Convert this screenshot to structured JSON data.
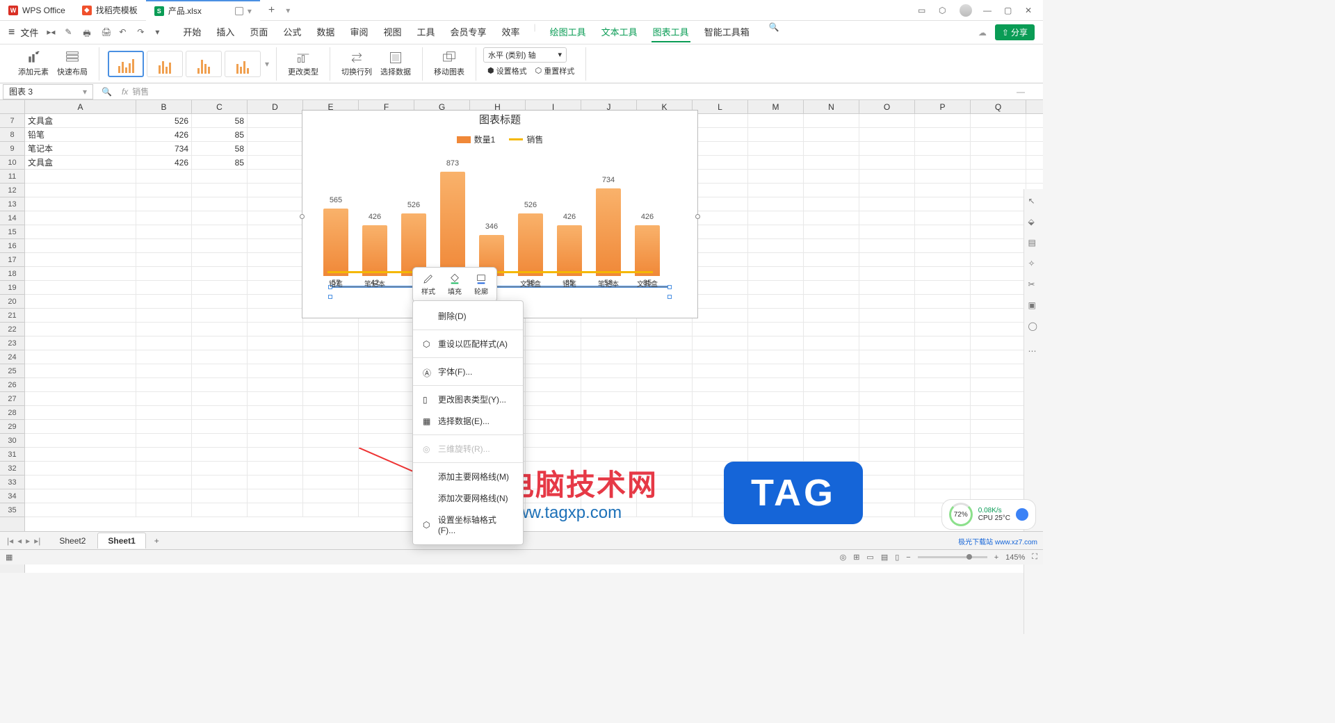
{
  "titlebar": {
    "tabs": [
      {
        "icon": "W",
        "label": "WPS Office",
        "color": "red"
      },
      {
        "icon": "D",
        "label": "找稻壳模板",
        "color": "orange"
      },
      {
        "icon": "S",
        "label": "产品.xlsx",
        "color": "green",
        "active": true
      }
    ]
  },
  "menu": {
    "file": "文件",
    "tabs": [
      "开始",
      "插入",
      "页面",
      "公式",
      "数据",
      "审阅",
      "视图",
      "工具",
      "会员专享",
      "效率"
    ],
    "tool_tabs": [
      "绘图工具",
      "文本工具",
      "图表工具",
      "智能工具箱"
    ],
    "active_tool": "图表工具",
    "share": "分享"
  },
  "ribbon": {
    "add_element": "添加元素",
    "quick_layout": "快速布局",
    "change_type": "更改类型",
    "switch_rc": "切换行列",
    "select_data": "选择数据",
    "move_chart": "移动图表",
    "axis_select": "水平 (类别) 轴",
    "set_format": "设置格式",
    "reset_style": "重置样式"
  },
  "namebox": "图表 3",
  "formula": "销售",
  "columns": {
    "A": 160,
    "B": 80,
    "C": 80,
    "D": 80,
    "E": 80,
    "F": 80,
    "G": 80,
    "H": 80,
    "I": 80,
    "J": 80,
    "K": 80,
    "L": 80,
    "M": 80,
    "N": 80,
    "O": 80,
    "P": 80,
    "Q": 80
  },
  "rows_start": 7,
  "rows_end": 35,
  "cells": {
    "7": {
      "A": "文具盒",
      "B": "526",
      "C": "58"
    },
    "8": {
      "A": "铅笔",
      "B": "426",
      "C": "85"
    },
    "9": {
      "A": "笔记本",
      "B": "734",
      "C": "58"
    },
    "10": {
      "A": "文具盒",
      "B": "426",
      "C": "85"
    }
  },
  "chart_data": {
    "type": "bar",
    "title": "图表标题",
    "series": [
      {
        "name": "数量1",
        "color": "#f08838",
        "type": "bar",
        "values": [
          565,
          426,
          526,
          873,
          346,
          526,
          426,
          734,
          426
        ]
      },
      {
        "name": "销售",
        "color": "#f5b800",
        "type": "line",
        "values": [
          57,
          42,
          null,
          null,
          84,
          58,
          85,
          58,
          85
        ]
      }
    ],
    "categories": [
      "铅笔",
      "笔记本",
      "文具盒",
      "铅笔",
      "笔记本",
      "文具盒",
      "铅笔",
      "笔记本",
      "文具盒"
    ],
    "cat_hidden_slots": [
      2,
      3,
      4
    ]
  },
  "mini_toolbar": {
    "style": "样式",
    "fill": "填充",
    "outline": "轮廓"
  },
  "context_menu": {
    "delete": "删除(D)",
    "reset_match": "重设以匹配样式(A)",
    "font": "字体(F)...",
    "change_chart_type": "更改图表类型(Y)...",
    "select_data": "选择数据(E)...",
    "rotate_3d": "三维旋转(R)...",
    "add_major_grid": "添加主要网格线(M)",
    "add_minor_grid": "添加次要网格线(N)",
    "set_axis_format": "设置坐标轴格式(F)..."
  },
  "sheets": {
    "tabs": [
      "Sheet2",
      "Sheet1"
    ],
    "active": "Sheet1"
  },
  "status": {
    "zoom": "145%",
    "perf": {
      "pct": "72%",
      "net": "0.08K/s",
      "cpu": "CPU 25°C"
    }
  },
  "watermark": {
    "text1": "电脑技术网",
    "sub1": "www.tagxp.com",
    "tag": "TAG",
    "corner": "极光下载站 www.xz7.com"
  }
}
